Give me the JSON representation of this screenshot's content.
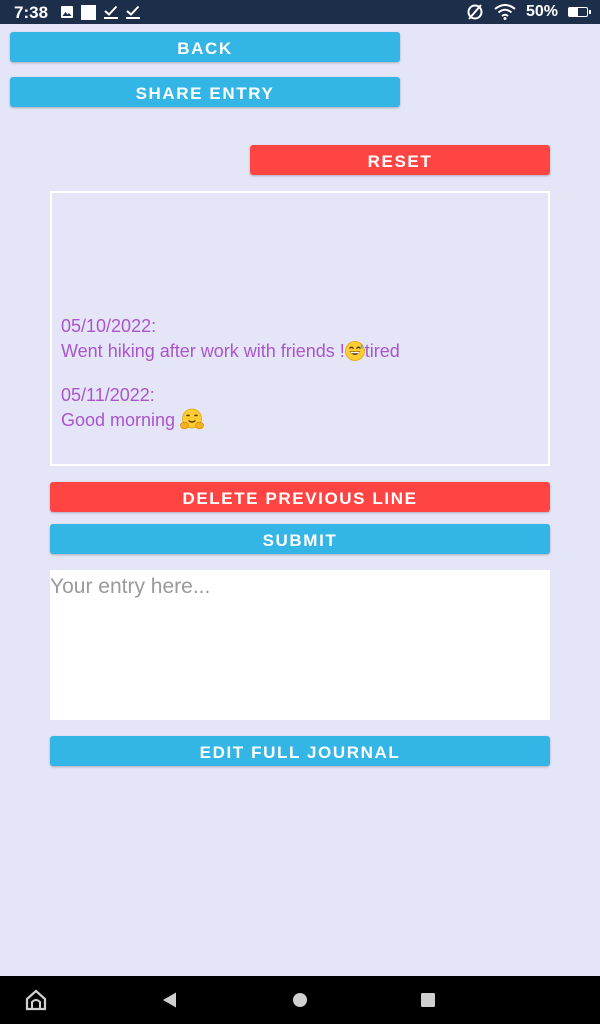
{
  "status_bar": {
    "time": "7:38",
    "battery": "50%",
    "battery_level": 0.5,
    "icons": [
      "image-icon",
      "square-icon",
      "checkbox-icon",
      "checkbox-icon",
      "no-sim-icon",
      "wifi-icon",
      "battery-icon"
    ]
  },
  "top_actions": {
    "back_label": "BACK",
    "share_label": "SHARE ENTRY",
    "reset_label": "RESET"
  },
  "journal": {
    "entries": [
      {
        "date": "05/10/2022:",
        "text": "Went hiking after work with friends !",
        "emoji": "grinning-sweat-emoji",
        "suffix": "tired"
      },
      {
        "date": "05/11/2022:",
        "text": "Good morning ",
        "emoji": "hugging-face-emoji",
        "suffix": ""
      }
    ]
  },
  "controls": {
    "delete_label": "DELETE PREVIOUS LINE",
    "submit_label": "SUBMIT",
    "entry_placeholder": "Your entry here...",
    "entry_value": "",
    "edit_full_label": "EDIT FULL JOURNAL"
  },
  "colors": {
    "accent_blue": "#33b5e5",
    "accent_red": "#ff4444",
    "journal_text": "#aa55cc",
    "background": "#e5e5f8"
  },
  "nav_bar": {
    "icons": [
      "home-icon",
      "back-icon",
      "home-circle-icon",
      "recents-icon"
    ]
  }
}
